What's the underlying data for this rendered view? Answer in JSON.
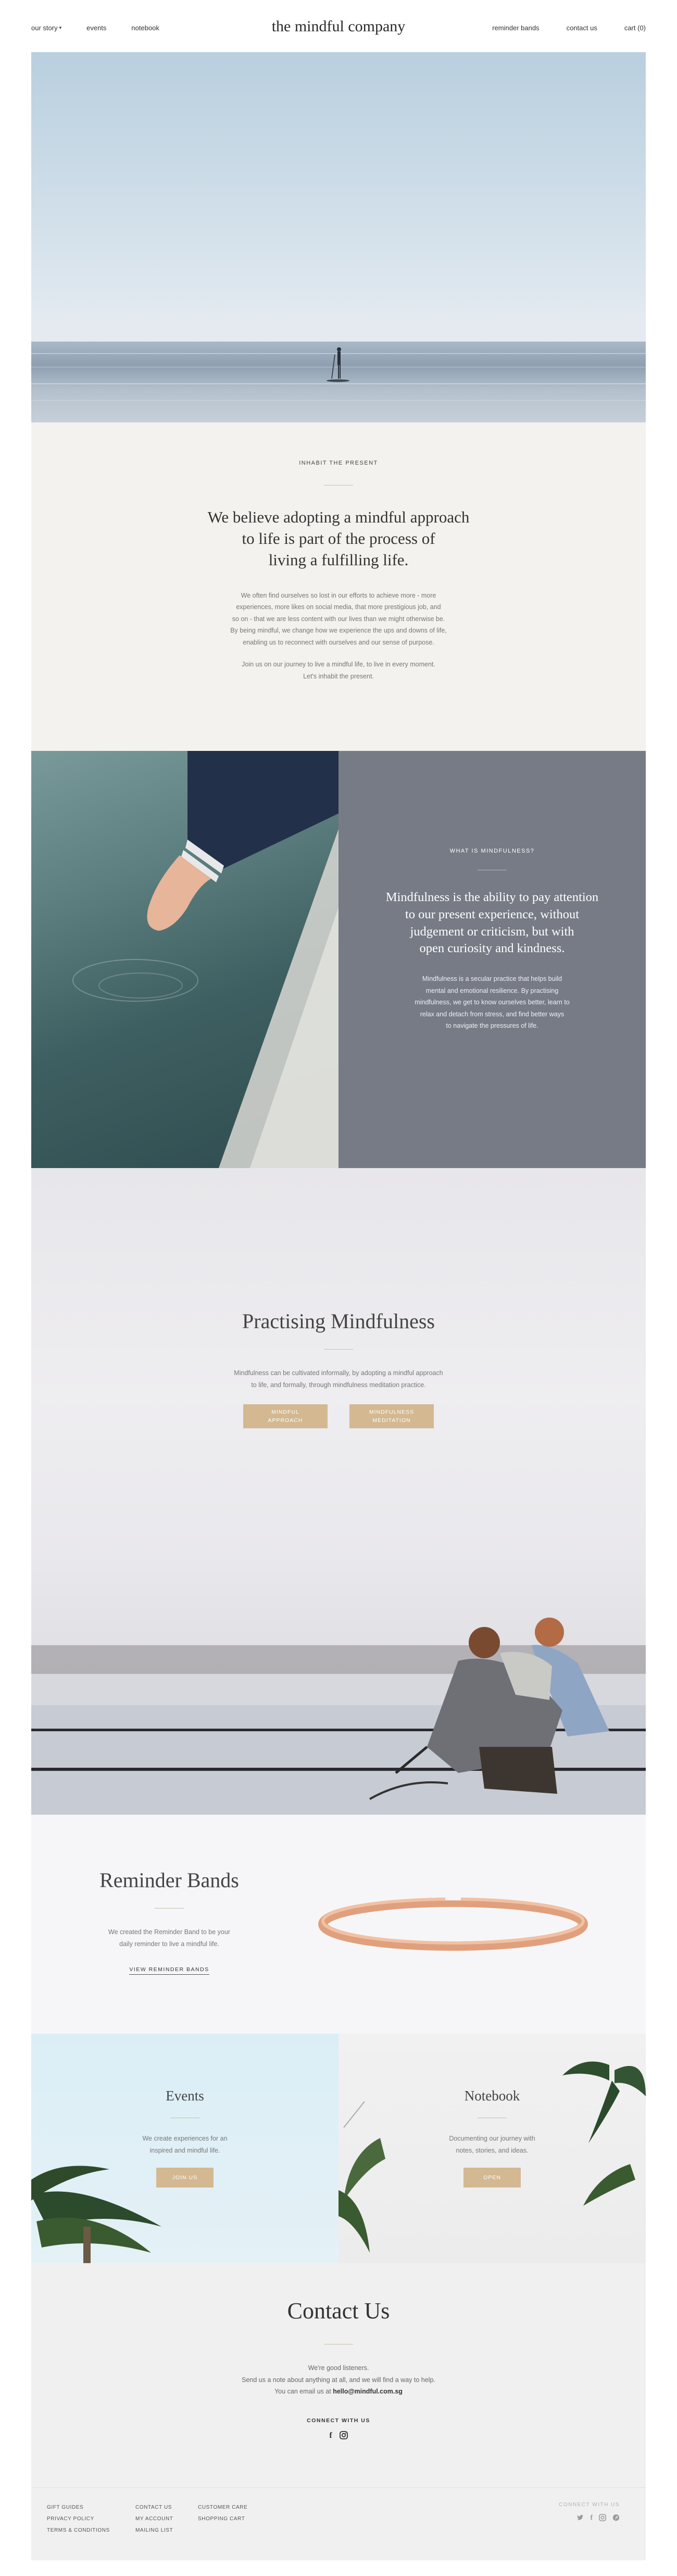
{
  "header": {
    "nav_left": [
      "our story",
      "events",
      "notebook"
    ],
    "logo": "the mindful company",
    "nav_right": [
      "reminder bands",
      "contact us",
      "cart (0)"
    ]
  },
  "intro": {
    "kicker": "INHABIT THE PRESENT",
    "heading_lines": [
      "We believe adopting a mindful approach",
      "to life is part of the process of",
      "living a fulfilling life."
    ],
    "body_lines": [
      "We often find ourselves so lost in our efforts to achieve more - more",
      "experiences, more likes on social media, that more prestigious job, and",
      "so on - that we are less content with our lives than we might otherwise be.",
      "By being mindful, we change how we experience the ups and downs of life,",
      "enabling us to reconnect with ourselves and our sense of purpose."
    ],
    "closing_lines": [
      "Join us on our journey to live a mindful life, to live in every moment.",
      "Let's inhabit the present."
    ]
  },
  "mindfulness": {
    "kicker": "WHAT IS MINDFULNESS?",
    "heading_lines": [
      "Mindfulness is the ability to pay attention",
      "to our present experience, without",
      "judgement or criticism, but with",
      "open curiosity and kindness."
    ],
    "body_lines": [
      "Mindfulness is a secular practice that helps build",
      "mental and emotional resilience. By practising",
      "mindfulness, we get to know ourselves better, learn to",
      "relax and detach from stress, and find better ways",
      "to navigate the pressures of life."
    ]
  },
  "practising": {
    "title": "Practising Mindfulness",
    "body_lines": [
      "Mindfulness can be cultivated informally, by adopting a mindful approach",
      "to life, and formally, through mindfulness meditation practice."
    ],
    "buttons": [
      {
        "line1": "MINDFUL",
        "line2": "APPROACH"
      },
      {
        "line1": "MINDFULNESS",
        "line2": "MEDITATION"
      }
    ]
  },
  "bands": {
    "title": "Reminder Bands",
    "body_lines": [
      "We created the Reminder Band to be your",
      "daily reminder to live a mindful life."
    ],
    "link": "VIEW REMINDER BANDS"
  },
  "events": {
    "title": "Events",
    "body_lines": [
      "We create experiences for an",
      "inspired and mindful life."
    ],
    "button": "JOIN US"
  },
  "notebook": {
    "title": "Notebook",
    "body_lines": [
      "Documenting our journey with",
      "notes, stories, and ideas."
    ],
    "button": "OPEN"
  },
  "contact": {
    "title": "Contact Us",
    "lines": [
      "We're good listeners.",
      "Send us a note about anything at all, and we will find a way to help."
    ],
    "email_prefix": "You can email us at",
    "email": "hello@mindful.com.sg",
    "connect": "CONNECT WITH US"
  },
  "footer": {
    "col1": [
      "GIFT GUIDES",
      "PRIVACY POLICY",
      "TERMS & CONDITIONS"
    ],
    "col2": [
      "CONTACT US",
      "MY ACCOUNT",
      "MAILING LIST"
    ],
    "col3": [
      "CUSTOMER CARE",
      "SHOPPING CART"
    ],
    "connect": "CONNECT WITH US"
  },
  "colors": {
    "accent_gold": "#d3b891",
    "grey_panel": "#767b85"
  }
}
